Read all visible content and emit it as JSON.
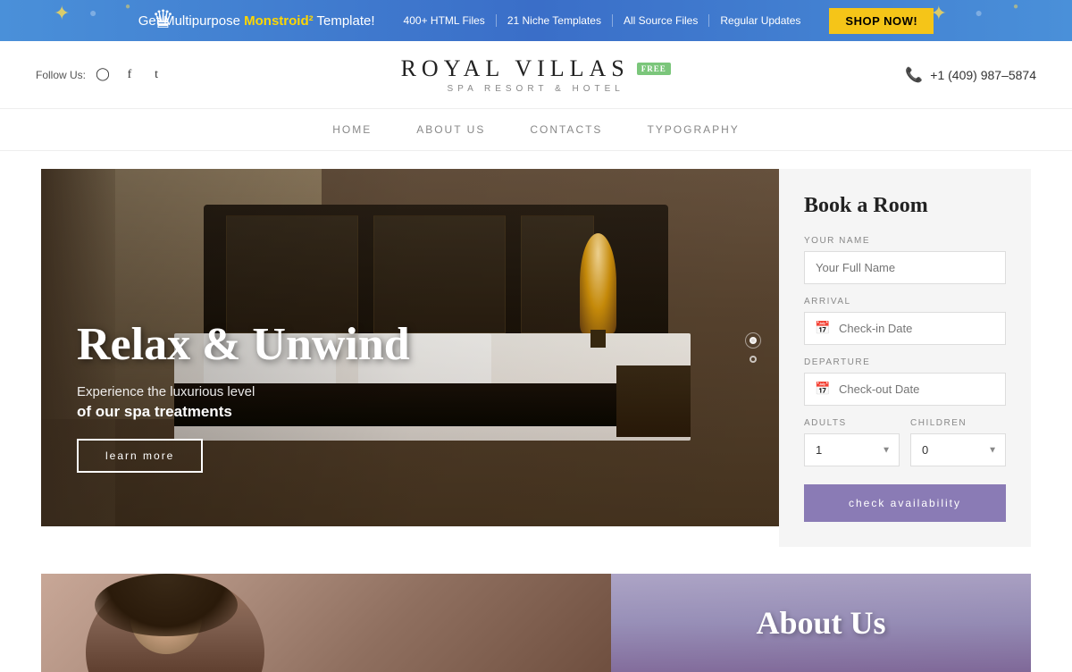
{
  "promo": {
    "text": "Get Multipurpose ",
    "brand": "Monstroid²",
    "template": " Template!",
    "links": [
      "400+ HTML Files",
      "21 Niche Templates",
      "All Source Files",
      "Regular Updates"
    ],
    "cta": "SHOP NOW!"
  },
  "header": {
    "follow_label": "Follow Us:",
    "logo_name": "ROYAL VILLAS",
    "free_badge": "FREE",
    "logo_sub": "SPA RESORT & HOTEL",
    "phone": "+1 (409) 987–5874"
  },
  "nav": {
    "items": [
      {
        "label": "HOME",
        "active": false
      },
      {
        "label": "ABOUT US",
        "active": false
      },
      {
        "label": "CONTACTS",
        "active": false
      },
      {
        "label": "TYPOGRAPHY",
        "active": false
      }
    ]
  },
  "hero": {
    "title": "Relax & Unwind",
    "sub1": "Experience the luxurious level",
    "sub2": "of our spa treatments",
    "cta": "learn more"
  },
  "booking": {
    "title": "Book a Room",
    "name_label": "YOUR NAME",
    "name_placeholder": "Your Full Name",
    "arrival_label": "ARRIVAL",
    "arrival_placeholder": "Check-in Date",
    "departure_label": "DEPARTURE",
    "departure_placeholder": "Check-out Date",
    "adults_label": "ADULTS",
    "adults_default": "1",
    "children_label": "CHILDREN",
    "children_default": "0",
    "cta": "check availability"
  },
  "below": {
    "about_title": "About Us"
  }
}
